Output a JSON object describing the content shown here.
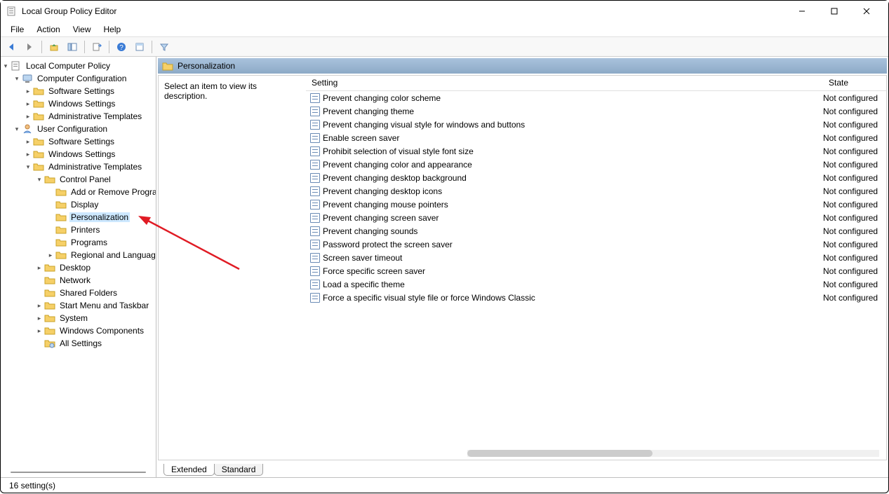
{
  "window": {
    "title": "Local Group Policy Editor"
  },
  "menu": {
    "items": [
      "File",
      "Action",
      "View",
      "Help"
    ]
  },
  "tree": {
    "root": "Local Computer Policy",
    "items": [
      {
        "depth": 0,
        "exp": "open",
        "icon": "policy",
        "label": "Local Computer Policy"
      },
      {
        "depth": 1,
        "exp": "open",
        "icon": "computer",
        "label": "Computer Configuration"
      },
      {
        "depth": 2,
        "exp": "closed",
        "icon": "folder",
        "label": "Software Settings"
      },
      {
        "depth": 2,
        "exp": "closed",
        "icon": "folder",
        "label": "Windows Settings"
      },
      {
        "depth": 2,
        "exp": "closed",
        "icon": "folder",
        "label": "Administrative Templates"
      },
      {
        "depth": 1,
        "exp": "open",
        "icon": "user",
        "label": "User Configuration"
      },
      {
        "depth": 2,
        "exp": "closed",
        "icon": "folder",
        "label": "Software Settings"
      },
      {
        "depth": 2,
        "exp": "closed",
        "icon": "folder",
        "label": "Windows Settings"
      },
      {
        "depth": 2,
        "exp": "open",
        "icon": "folder",
        "label": "Administrative Templates"
      },
      {
        "depth": 3,
        "exp": "open",
        "icon": "folder",
        "label": "Control Panel"
      },
      {
        "depth": 4,
        "exp": "none",
        "icon": "folder",
        "label": "Add or Remove Programs"
      },
      {
        "depth": 4,
        "exp": "none",
        "icon": "folder",
        "label": "Display"
      },
      {
        "depth": 4,
        "exp": "none",
        "icon": "folder",
        "label": "Personalization",
        "selected": true
      },
      {
        "depth": 4,
        "exp": "none",
        "icon": "folder",
        "label": "Printers"
      },
      {
        "depth": 4,
        "exp": "none",
        "icon": "folder",
        "label": "Programs"
      },
      {
        "depth": 4,
        "exp": "closed",
        "icon": "folder",
        "label": "Regional and Language Options"
      },
      {
        "depth": 3,
        "exp": "closed",
        "icon": "folder",
        "label": "Desktop"
      },
      {
        "depth": 3,
        "exp": "none",
        "icon": "folder",
        "label": "Network"
      },
      {
        "depth": 3,
        "exp": "none",
        "icon": "folder",
        "label": "Shared Folders"
      },
      {
        "depth": 3,
        "exp": "closed",
        "icon": "folder",
        "label": "Start Menu and Taskbar"
      },
      {
        "depth": 3,
        "exp": "closed",
        "icon": "folder",
        "label": "System"
      },
      {
        "depth": 3,
        "exp": "closed",
        "icon": "folder",
        "label": "Windows Components"
      },
      {
        "depth": 3,
        "exp": "none",
        "icon": "settings",
        "label": "All Settings"
      }
    ]
  },
  "content": {
    "header": "Personalization",
    "description": "Select an item to view its description.",
    "columns": {
      "setting": "Setting",
      "state": "State"
    },
    "rows": [
      {
        "setting": "Prevent changing color scheme",
        "state": "Not configured"
      },
      {
        "setting": "Prevent changing theme",
        "state": "Not configured"
      },
      {
        "setting": "Prevent changing visual style for windows and buttons",
        "state": "Not configured"
      },
      {
        "setting": "Enable screen saver",
        "state": "Not configured"
      },
      {
        "setting": "Prohibit selection of visual style font size",
        "state": "Not configured"
      },
      {
        "setting": "Prevent changing color and appearance",
        "state": "Not configured"
      },
      {
        "setting": "Prevent changing desktop background",
        "state": "Not configured"
      },
      {
        "setting": "Prevent changing desktop icons",
        "state": "Not configured"
      },
      {
        "setting": "Prevent changing mouse pointers",
        "state": "Not configured"
      },
      {
        "setting": "Prevent changing screen saver",
        "state": "Not configured"
      },
      {
        "setting": "Prevent changing sounds",
        "state": "Not configured"
      },
      {
        "setting": "Password protect the screen saver",
        "state": "Not configured"
      },
      {
        "setting": "Screen saver timeout",
        "state": "Not configured"
      },
      {
        "setting": "Force specific screen saver",
        "state": "Not configured"
      },
      {
        "setting": "Load a specific theme",
        "state": "Not configured"
      },
      {
        "setting": "Force a specific visual style file or force Windows Classic",
        "state": "Not configured"
      }
    ],
    "tabs": {
      "extended": "Extended",
      "standard": "Standard"
    }
  },
  "status": {
    "text": "16 setting(s)"
  }
}
